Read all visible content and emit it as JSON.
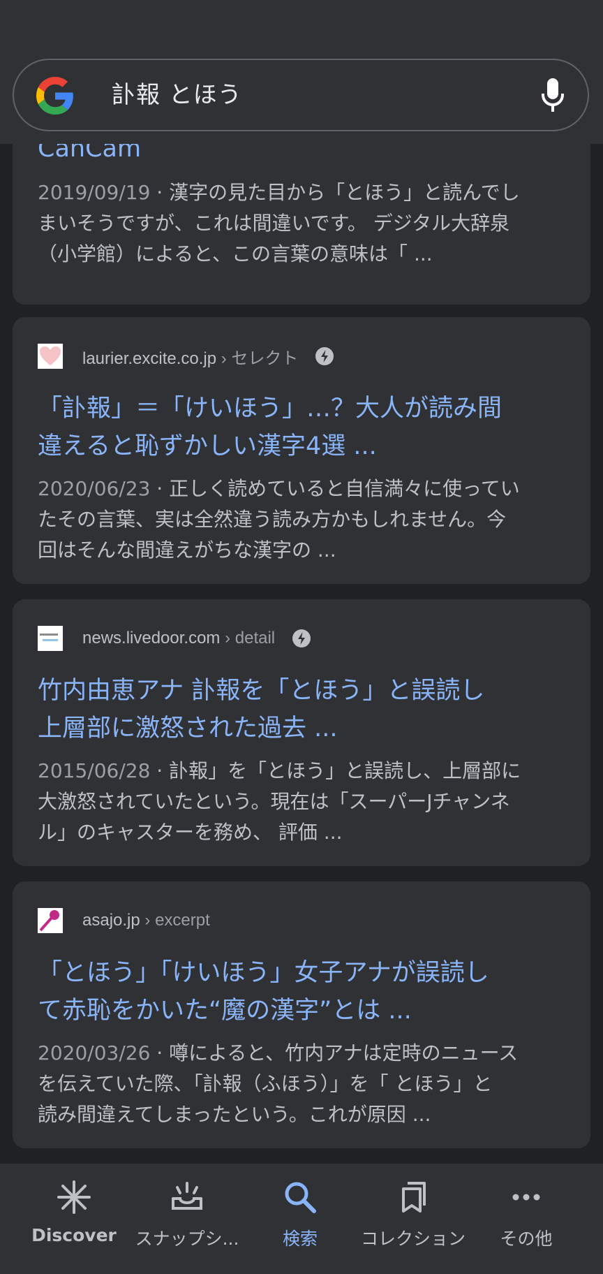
{
  "search": {
    "query": "訃報 とほう"
  },
  "results": [
    {
      "title_lines": [
        "CanCam"
      ],
      "date": "2019/09/19",
      "snippet_lines": [
        " · 漢字の見た目から「とほう」と読んでし",
        "まいそうですが、これは間違いです。 デジタル大辞泉",
        "（小学館）によると、この言葉の意味は「 ..."
      ]
    },
    {
      "site": "laurier.excite.co.jp",
      "crumb": " › セレクト",
      "title_lines": [
        "「訃報」＝「けいほう」…？大人が読み間",
        "違えると恥ずかしい漢字4選 ..."
      ],
      "date": "2020/06/23",
      "snippet_lines": [
        " · 正しく読めていると自信満々に使ってい",
        "たその言葉、実は全然違う読み方かもしれません。今",
        "回はそんな間違えがちな漢字の ..."
      ]
    },
    {
      "site": "news.livedoor.com",
      "crumb": " › detail",
      "title_lines": [
        "竹内由恵アナ 訃報を「とほう」と誤読し",
        "上層部に激怒された過去 ..."
      ],
      "date": "2015/06/28",
      "snippet_lines": [
        " · 訃報」を「とほう」と誤読し、上層部に",
        "大激怒されていたという。現在は「スーパーJチャンネ",
        "ル」のキャスターを務め、 評価 ..."
      ]
    },
    {
      "site": "asajo.jp",
      "crumb": " › excerpt",
      "title_lines": [
        "「とほう」「けいほう」女子アナが誤読し",
        "て赤恥をかいた“魔の漢字”とは ..."
      ],
      "date": "2020/03/26",
      "snippet_lines": [
        " · 噂によると、竹内アナは定時のニュース",
        "を伝えていた際、「訃報（ふほう）」を「 とほう」と",
        "読み間違えてしまったという。これが原因 ..."
      ]
    }
  ],
  "nav": {
    "discover": "Discover",
    "snapshot": "スナップシ...",
    "search": "検索",
    "collections": "コレクション",
    "more": "その他"
  },
  "colors": {
    "background": "#202124",
    "card": "#303134",
    "link": "#8ab4f8",
    "text": "#bdc1c6"
  }
}
